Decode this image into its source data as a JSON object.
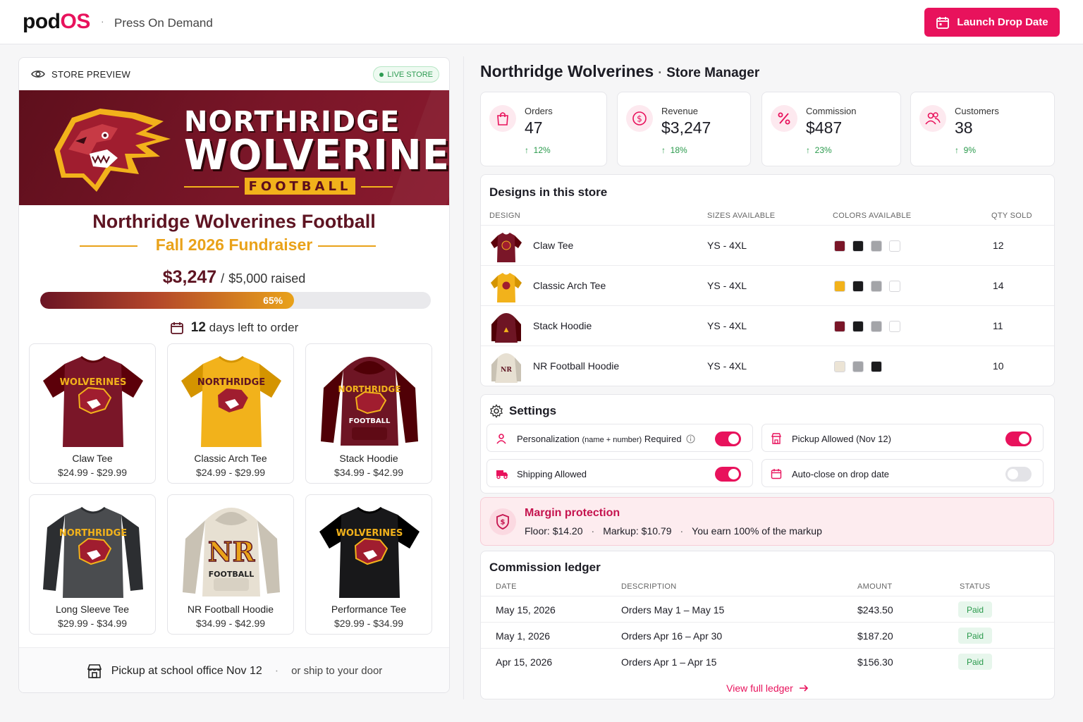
{
  "brand": {
    "pod": "pod",
    "os": "OS",
    "subtitle": "Press On Demand",
    "sep": "·"
  },
  "header": {
    "launch_label": "Launch Drop Date"
  },
  "preview": {
    "title": "STORE PREVIEW",
    "live_label": "LIVE STORE",
    "banner": {
      "line1": "NORTHRIDGE",
      "line2": "WOLVERINES",
      "line3": "FOOTBALL"
    },
    "store_name": "Northridge Wolverines Football",
    "store_sub": "Fall 2026 Fundraiser",
    "raised_amount": "$3,247",
    "raised_sep": "/",
    "raised_goal": "$5,000 raised",
    "progress_percent": 65,
    "progress_label": "65%",
    "days_num": "12",
    "days_text": "days left to order",
    "products": [
      {
        "name": "Claw Tee",
        "price": "$24.99 - $29.99",
        "color": "#7a1628",
        "text": "WOLVERINES"
      },
      {
        "name": "Classic Arch Tee",
        "price": "$24.99 - $29.99",
        "color": "#f2b21b",
        "text": "NORTHRIDGE"
      },
      {
        "name": "Stack Hoodie",
        "price": "$34.99 - $42.99",
        "color": "#6e1524",
        "text": "NORTHRIDGE"
      },
      {
        "name": "Long Sleeve Tee",
        "price": "$29.99 - $34.99",
        "color": "#4a4c4f",
        "text": "NORTHRIDGE"
      },
      {
        "name": "NR Football Hoodie",
        "price": "$34.99 - $42.99",
        "color": "#e7e0d2",
        "text": "NR"
      },
      {
        "name": "Performance Tee",
        "price": "$29.99 - $34.99",
        "color": "#18181a",
        "text": "WOLVERINES"
      }
    ],
    "pickup_text": "Pickup at school office Nov 12",
    "pickup_sep": "·",
    "ship_text": "or ship to your door"
  },
  "manager": {
    "store": "Northridge Wolverines",
    "sep": "·",
    "role": "Store Manager",
    "stats": [
      {
        "label": "Orders",
        "value": "47",
        "delta": "12%",
        "icon": "bag-icon"
      },
      {
        "label": "Revenue",
        "value": "$3,247",
        "delta": "18%",
        "icon": "dollar-icon"
      },
      {
        "label": "Commission",
        "value": "$487",
        "delta": "23%",
        "icon": "percent-icon"
      },
      {
        "label": "Customers",
        "value": "38",
        "delta": "9%",
        "icon": "users-icon"
      }
    ],
    "designs": {
      "title": "Designs in this store",
      "headers": {
        "design": "DESIGN",
        "sizes": "SIZES AVAILABLE",
        "colors": "COLORS AVAILABLE",
        "qty": "QTY SOLD"
      },
      "rows": [
        {
          "name": "Claw Tee",
          "sizes": "YS - 4XL",
          "qty": "12",
          "thumb": "#7a1628",
          "colors": [
            "#7a1628",
            "#1b1b1d",
            "#a3a4a8",
            "#ffffff"
          ]
        },
        {
          "name": "Classic Arch Tee",
          "sizes": "YS - 4XL",
          "qty": "14",
          "thumb": "#f2b21b",
          "colors": [
            "#f2b21b",
            "#1b1b1d",
            "#a3a4a8",
            "#ffffff"
          ]
        },
        {
          "name": "Stack Hoodie",
          "sizes": "YS - 4XL",
          "qty": "11",
          "thumb": "#6e1524",
          "colors": [
            "#7a1628",
            "#1b1b1d",
            "#a3a4a8",
            "#ffffff"
          ]
        },
        {
          "name": "NR Football Hoodie",
          "sizes": "YS - 4XL",
          "qty": "10",
          "thumb": "#e7e0d2",
          "colors": [
            "#ece4d5",
            "#a3a4a8",
            "#1b1b1d"
          ]
        }
      ]
    },
    "settings": {
      "title": "Settings",
      "items": [
        {
          "label": "Personalization",
          "small": "(name + number)",
          "suffix": "Required",
          "on": true
        },
        {
          "label": "Pickup",
          "small": "",
          "suffix": "Allowed (Nov 12)",
          "on": true
        },
        {
          "label": "Shipping",
          "small": "",
          "suffix": "Allowed",
          "on": true
        },
        {
          "label": "Auto-close on drop date",
          "small": "",
          "suffix": "",
          "on": false
        }
      ]
    },
    "margin": {
      "title": "Margin protection",
      "floor_label": "Floor:",
      "floor": "$14.20",
      "markup_label": "Markup:",
      "markup": "$10.79",
      "earn": "You earn 100% of the markup",
      "sep": "·"
    },
    "ledger": {
      "title": "Commission ledger",
      "headers": {
        "date": "DATE",
        "desc": "DESCRIPTION",
        "amount": "AMOUNT",
        "status": "STATUS"
      },
      "rows": [
        {
          "date": "May 15, 2026",
          "desc": "Orders May 1 – May 15",
          "amount": "$243.50",
          "status": "Paid"
        },
        {
          "date": "May 1, 2026",
          "desc": "Orders Apr 16 – Apr 30",
          "amount": "$187.20",
          "status": "Paid"
        },
        {
          "date": "Apr 15, 2026",
          "desc": "Orders Apr 1 – Apr 15",
          "amount": "$156.30",
          "status": "Paid"
        }
      ],
      "view_all": "View full ledger"
    }
  },
  "colors": {
    "accent": "#e8125c",
    "maroon": "#5e1422",
    "gold": "#e9a21a",
    "success": "#2a9a4c"
  }
}
